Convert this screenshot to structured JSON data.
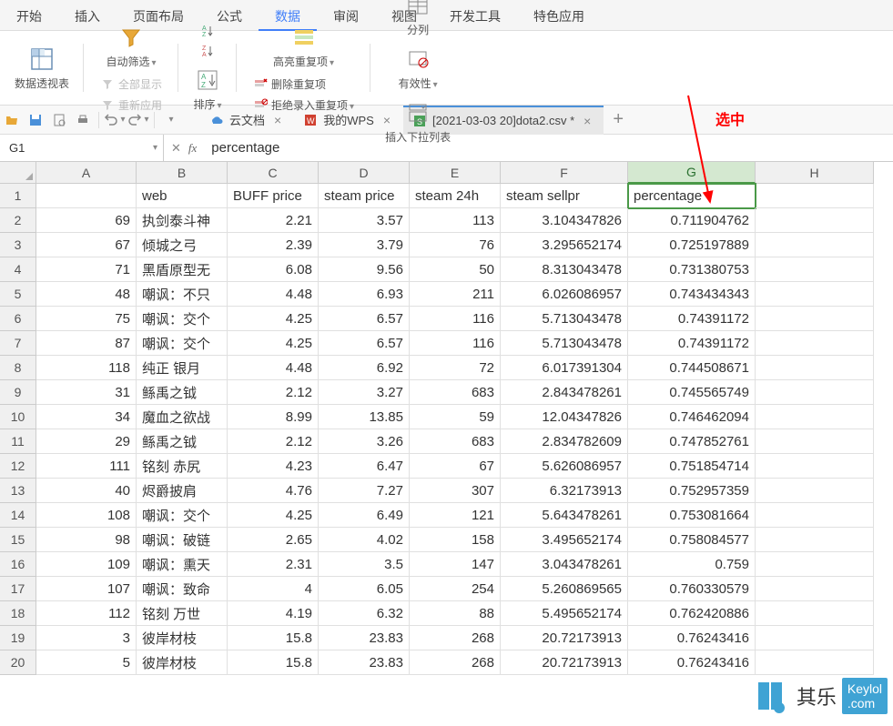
{
  "ribbon_tabs": [
    "开始",
    "插入",
    "页面布局",
    "公式",
    "数据",
    "审阅",
    "视图",
    "开发工具",
    "特色应用"
  ],
  "active_tab_index": 4,
  "ribbon": {
    "pivot": "数据透视表",
    "autofilter": "自动筛选",
    "showall": "全部显示",
    "reapply": "重新应用",
    "sort": "排序",
    "highlight_dup": "高亮重复项",
    "remove_dup": "删除重复项",
    "reject_dup": "拒绝录入重复项",
    "split": "分列",
    "validity": "有效性",
    "dropdown": "插入下拉列表"
  },
  "annotation": "选中",
  "quick_access": {
    "cloud_doc": "云文档",
    "mywps": "我的WPS",
    "active_file": "[2021-03-03 20]dota2.csv *"
  },
  "name_box": "G1",
  "formula": "percentage",
  "columns": [
    "A",
    "B",
    "C",
    "D",
    "E",
    "F",
    "G",
    "H"
  ],
  "selected_col": "G",
  "selected_cell": {
    "row": 1,
    "col": "G"
  },
  "headers_row": [
    "",
    "web",
    "BUFF price",
    "steam price",
    "steam 24h",
    "steam sellpr",
    "percentage"
  ],
  "rows": [
    {
      "n": 1,
      "A": "",
      "B": "web",
      "C": "BUFF price",
      "D": "steam price",
      "E": "steam 24h",
      "F": "steam sellpr",
      "G": "percentage"
    },
    {
      "n": 2,
      "A": "69",
      "B": "执剑泰斗神",
      "C": "2.21",
      "D": "3.57",
      "E": "113",
      "F": "3.104347826",
      "G": "0.711904762"
    },
    {
      "n": 3,
      "A": "67",
      "B": "倾城之弓",
      "C": "2.39",
      "D": "3.79",
      "E": "76",
      "F": "3.295652174",
      "G": "0.725197889"
    },
    {
      "n": 4,
      "A": "71",
      "B": "黑盾原型无",
      "C": "6.08",
      "D": "9.56",
      "E": "50",
      "F": "8.313043478",
      "G": "0.731380753"
    },
    {
      "n": 5,
      "A": "48",
      "B": "嘲讽：不只",
      "C": "4.48",
      "D": "6.93",
      "E": "211",
      "F": "6.026086957",
      "G": "0.743434343"
    },
    {
      "n": 6,
      "A": "75",
      "B": "嘲讽：交个",
      "C": "4.25",
      "D": "6.57",
      "E": "116",
      "F": "5.713043478",
      "G": "0.74391172"
    },
    {
      "n": 7,
      "A": "87",
      "B": "嘲讽：交个",
      "C": "4.25",
      "D": "6.57",
      "E": "116",
      "F": "5.713043478",
      "G": "0.74391172"
    },
    {
      "n": 8,
      "A": "118",
      "B": "纯正 银月",
      "C": "4.48",
      "D": "6.92",
      "E": "72",
      "F": "6.017391304",
      "G": "0.744508671"
    },
    {
      "n": 9,
      "A": "31",
      "B": "鲧禹之钺",
      "C": "2.12",
      "D": "3.27",
      "E": "683",
      "F": "2.843478261",
      "G": "0.745565749"
    },
    {
      "n": 10,
      "A": "34",
      "B": "魔血之欲战",
      "C": "8.99",
      "D": "13.85",
      "E": "59",
      "F": "12.04347826",
      "G": "0.746462094"
    },
    {
      "n": 11,
      "A": "29",
      "B": "鲧禹之钺",
      "C": "2.12",
      "D": "3.26",
      "E": "683",
      "F": "2.834782609",
      "G": "0.747852761"
    },
    {
      "n": 12,
      "A": "111",
      "B": "铭刻 赤尻",
      "C": "4.23",
      "D": "6.47",
      "E": "67",
      "F": "5.626086957",
      "G": "0.751854714"
    },
    {
      "n": 13,
      "A": "40",
      "B": "烬爵披肩",
      "C": "4.76",
      "D": "7.27",
      "E": "307",
      "F": "6.32173913",
      "G": "0.752957359"
    },
    {
      "n": 14,
      "A": "108",
      "B": "嘲讽：交个",
      "C": "4.25",
      "D": "6.49",
      "E": "121",
      "F": "5.643478261",
      "G": "0.753081664"
    },
    {
      "n": 15,
      "A": "98",
      "B": "嘲讽：破链",
      "C": "2.65",
      "D": "4.02",
      "E": "158",
      "F": "3.495652174",
      "G": "0.758084577"
    },
    {
      "n": 16,
      "A": "109",
      "B": "嘲讽：熏天",
      "C": "2.31",
      "D": "3.5",
      "E": "147",
      "F": "3.043478261",
      "G": "0.759"
    },
    {
      "n": 17,
      "A": "107",
      "B": "嘲讽：致命",
      "C": "4",
      "D": "6.05",
      "E": "254",
      "F": "5.260869565",
      "G": "0.760330579"
    },
    {
      "n": 18,
      "A": "112",
      "B": "铭刻 万世",
      "C": "4.19",
      "D": "6.32",
      "E": "88",
      "F": "5.495652174",
      "G": "0.762420886"
    },
    {
      "n": 19,
      "A": "3",
      "B": "彼岸材枝",
      "C": "15.8",
      "D": "23.83",
      "E": "268",
      "F": "20.72173913",
      "G": "0.76243416"
    },
    {
      "n": 20,
      "A": "5",
      "B": "彼岸材枝",
      "C": "15.8",
      "D": "23.83",
      "E": "268",
      "F": "20.72173913",
      "G": "0.76243416"
    }
  ],
  "watermark": {
    "text1": "其乐",
    "text2": "Keylol\n.com"
  }
}
